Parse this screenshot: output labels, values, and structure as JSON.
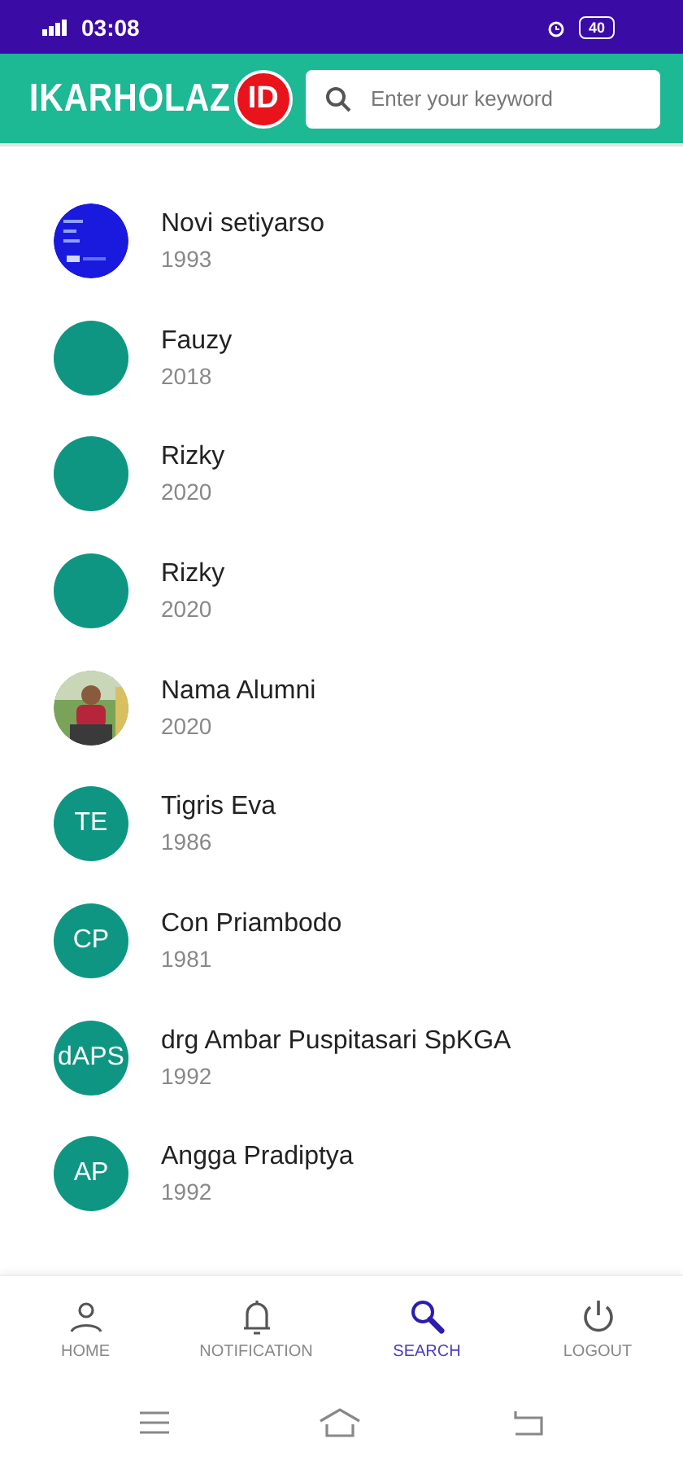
{
  "status_bar": {
    "time": "03:08",
    "battery": "40"
  },
  "header": {
    "logo": "IKARHOLAZ",
    "logo_badge": "ID",
    "search": {
      "placeholder": "Enter your keyword"
    }
  },
  "alumni": [
    {
      "name": "Novi setiyarso",
      "year": "1993"
    },
    {
      "name": "Fauzy",
      "year": "2018",
      "avatar": {
        "kind": "blank"
      }
    },
    {
      "name": "Rizky",
      "year": "2020",
      "avatar": {
        "kind": "blank"
      }
    },
    {
      "name": "Rizky",
      "year": "2020",
      "avatar": {
        "kind": "blank"
      }
    },
    {
      "name": "Nama Alumni",
      "year": "2020"
    },
    {
      "name": "Tigris Eva",
      "year": "1986",
      "avatar": {
        "kind": "initials",
        "text": "TE"
      }
    },
    {
      "name": "Con Priambodo",
      "year": "1981",
      "avatar": {
        "kind": "initials",
        "text": "CP"
      }
    },
    {
      "name": "drg Ambar Puspitasari SpKGA",
      "year": "1992",
      "avatar": {
        "kind": "initials",
        "text": "dAPS"
      }
    },
    {
      "name": "Angga Pradiptya",
      "year": "1992",
      "avatar": {
        "kind": "initials",
        "text": "AP"
      }
    }
  ],
  "bottom_nav": [
    {
      "label": "HOME",
      "kind": "home",
      "selected": false
    },
    {
      "label": "NOTIFICATION",
      "kind": "notification",
      "selected": false
    },
    {
      "label": "SEARCH",
      "kind": "search",
      "selected": true
    },
    {
      "label": "LOGOUT",
      "kind": "logout",
      "selected": false
    }
  ]
}
